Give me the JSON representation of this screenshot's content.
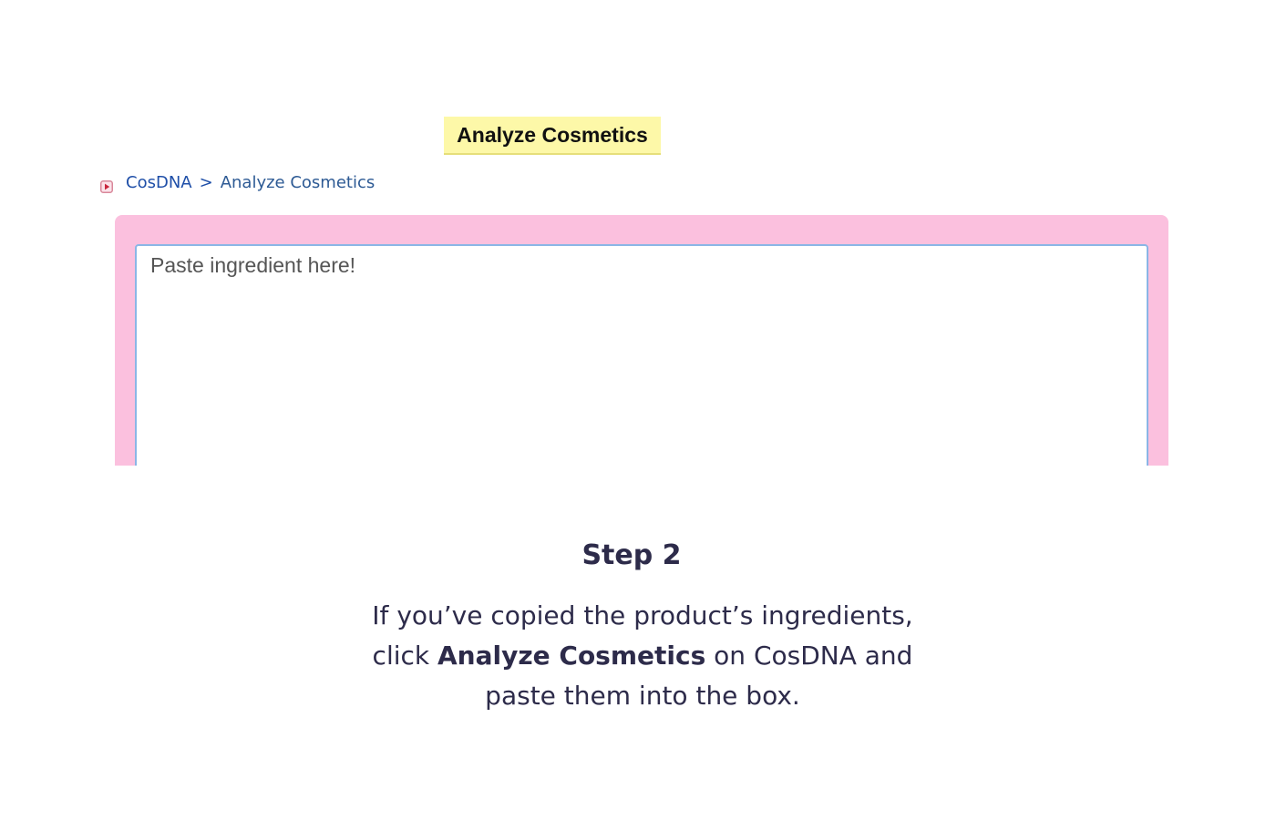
{
  "page_title": "Analyze Cosmetics",
  "breadcrumb": {
    "icon": "play-arrow-icon",
    "root": "CosDNA",
    "separator": ">",
    "current": "Analyze Cosmetics"
  },
  "ingredient_input": {
    "placeholder": "Paste ingredient here!",
    "value": ""
  },
  "colors": {
    "title_highlight": "#fdf8a8",
    "panel_pink": "#fbc0de",
    "input_border": "#8ab6e6",
    "link_blue": "#1f4fa8",
    "caption_text": "#2d2b4a"
  },
  "instructions": {
    "step_label": "Step 2",
    "line1": "If you’ve copied the product’s ingredients,",
    "line2_before": "click ",
    "line2_bold": "Analyze Cosmetics",
    "line2_after": " on CosDNA and",
    "line3": "paste them into the box."
  }
}
